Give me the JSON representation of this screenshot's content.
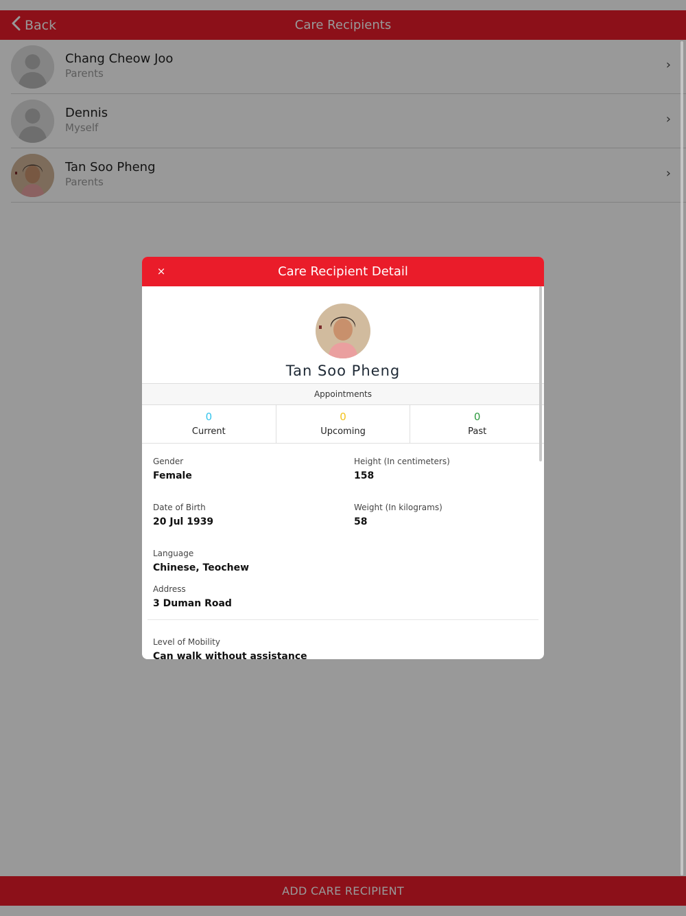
{
  "navbar": {
    "back_label": "Back",
    "title": "Care Recipients"
  },
  "recipients": [
    {
      "name": "Chang Cheow Joo",
      "relationship": "Parents",
      "avatar": "placeholder-avatar"
    },
    {
      "name": "Dennis",
      "relationship": "Myself",
      "avatar": "placeholder-avatar"
    },
    {
      "name": "Tan Soo Pheng",
      "relationship": "Parents",
      "avatar": "photo-avatar"
    }
  ],
  "bottom_button_label": "ADD CARE RECIPIENT",
  "modal": {
    "close_icon": "×",
    "title": "Care Recipient Detail",
    "name": "Tan Soo Pheng",
    "appointments": {
      "heading": "Appointments",
      "current": {
        "count": "0",
        "label": "Current",
        "color": "#33c4ec"
      },
      "upcoming": {
        "count": "0",
        "label": "Upcoming",
        "color": "#f2c21b"
      },
      "past": {
        "count": "0",
        "label": "Past",
        "color": "#2e9a3f"
      }
    },
    "details": {
      "gender": {
        "label": "Gender",
        "value": "Female"
      },
      "height": {
        "label": "Height (In centimeters)",
        "value": "158"
      },
      "dob": {
        "label": "Date of Birth",
        "value": "20 Jul 1939"
      },
      "weight": {
        "label": "Weight (In kilograms)",
        "value": "58"
      },
      "language": {
        "label": "Language",
        "value": "Chinese, Teochew"
      },
      "address": {
        "label": "Address",
        "value": "3 Duman Road"
      },
      "mobility": {
        "label": "Level of Mobility",
        "value": "Can walk without assistance"
      }
    }
  },
  "colors": {
    "brand_red": "#ea1c2a"
  }
}
